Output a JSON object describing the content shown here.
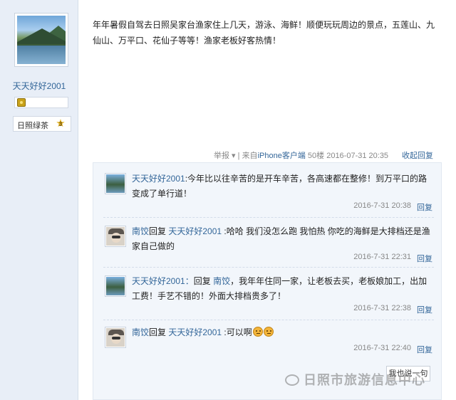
{
  "author": {
    "name": "天天好好2001",
    "group": "日照绿茶",
    "level": "3",
    "avatar_icon": "landscape-avatar-icon"
  },
  "post": {
    "text": "年年暑假自驾去日照吴家台渔家住上几天，游泳、海鲜！顺便玩玩周边的景点，五莲山、九仙山、万平口、花仙子等等！渔家老板好客热情！",
    "report_label": "举报",
    "source_prefix": "来自",
    "source_name": "iPhone客户端",
    "floor": "50楼",
    "datetime": "2016-07-31 20:35",
    "fold_reply_label": "收起回复"
  },
  "comments": [
    {
      "user": "天天好好2001",
      "sep": ":",
      "text": "今年比以往辛苦的是开车辛苦，各高速都在整修！到万平口的路变成了单行道！",
      "time": "2016-7-31 20:38",
      "reply_label": "回复"
    },
    {
      "user": "南饺",
      "reply_word": "回复",
      "target": "天天好好2001",
      "sep": " :",
      "text": "哈哈 我们没怎么跑 我怕热 你吃的海鲜是大排档还是渔家自己做的",
      "time": "2016-7-31 22:31",
      "reply_label": "回复"
    },
    {
      "user": "天天好好2001",
      "reply_word": "回复",
      "target": "南饺",
      "sep": "：",
      "text": "我年年住同一家，让老板去买，老板娘加工，出加工费！手艺不错的！外面大排档贵多了！",
      "time": "2016-7-31 22:38",
      "reply_label": "回复"
    },
    {
      "user": "南饺",
      "reply_word": "回复",
      "target": "天天好好2001",
      "sep": " :",
      "text": "可以啊",
      "time": "2016-7-31 22:40",
      "reply_label": "回复"
    }
  ],
  "say_button_label": "我也说一句",
  "watermark": "日照市旅游信息中心",
  "colors": {
    "link": "#336699",
    "sidebar": "#e8eef7",
    "comment_bg": "#f2f6fb"
  }
}
